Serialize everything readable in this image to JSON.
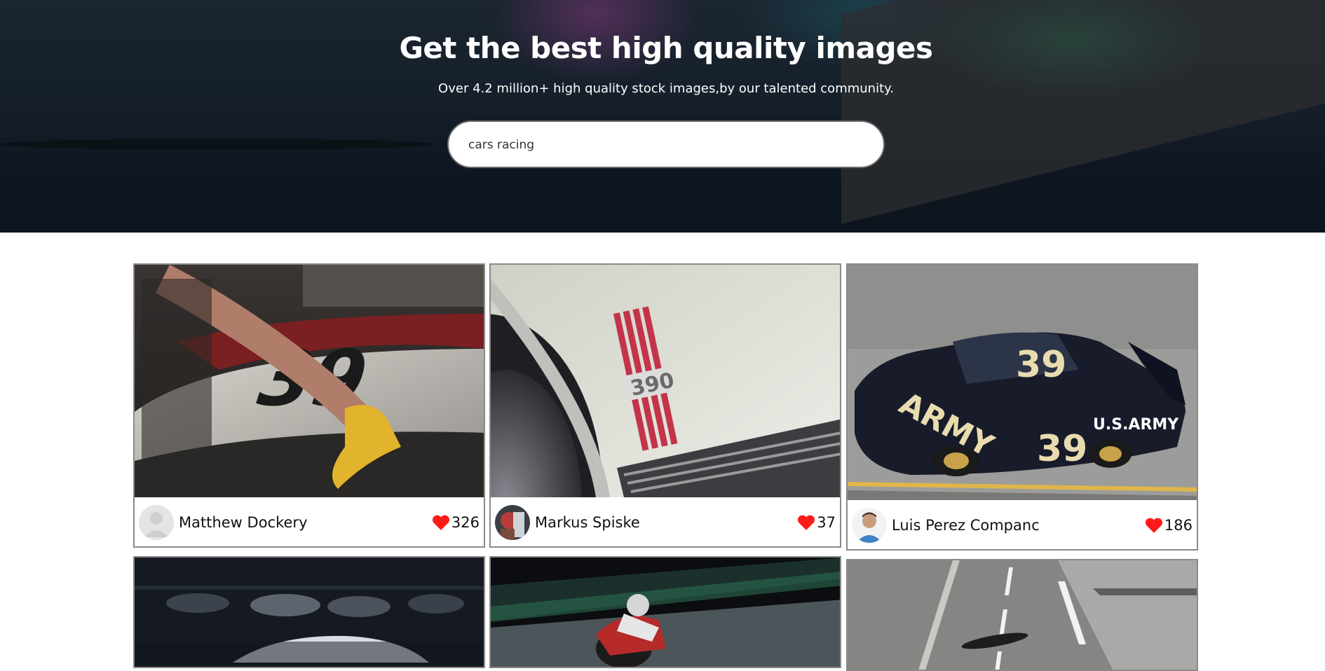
{
  "hero": {
    "title": "Get the best high quality images",
    "subtitle": "Over 4.2 million+ high quality stock images,by our talented community."
  },
  "search": {
    "value": "cars racing",
    "icon": "search-field"
  },
  "cards": [
    {
      "author": "Matthew Dockery",
      "likes": "326",
      "avatar": "default-avatar-icon",
      "image": "car hood with number 39 being wiped"
    },
    {
      "author": "Markus Spiske",
      "likes": "37",
      "avatar": "photo-avatar",
      "image": "vintage car 390 emblem"
    },
    {
      "author": "Luis Perez Companc",
      "likes": "186",
      "avatar": "photo-avatar",
      "image": "number 39 army stock car"
    }
  ],
  "colors": {
    "heart": "#ff1a1a",
    "card_border": "#8a8a8a",
    "hero_bg": "#16202b",
    "aurora_green": "#28c882"
  }
}
